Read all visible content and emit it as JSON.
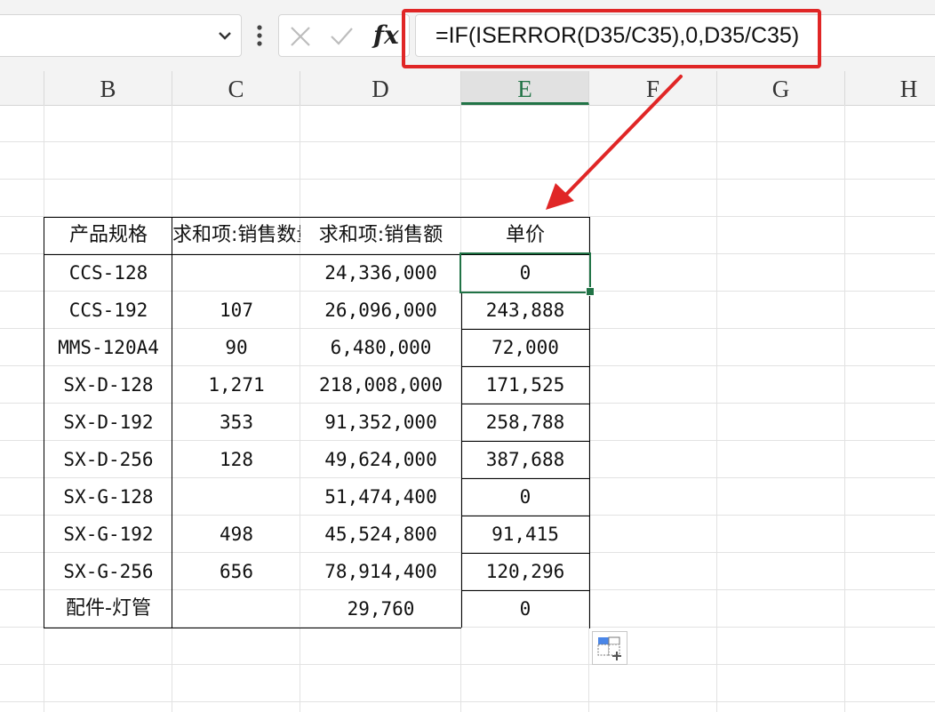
{
  "formula_bar": {
    "fx_label": "fx",
    "formula": "=IF(ISERROR(D35/C35),0,D35/C35)"
  },
  "columns": [
    "B",
    "C",
    "D",
    "E",
    "F",
    "G",
    "H"
  ],
  "selected_column": "E",
  "table": {
    "headers": [
      "产品规格",
      "求和项:销售数量",
      "求和项:销售额",
      "单价"
    ],
    "rows": [
      [
        "CCS-128",
        "",
        "24,336,000",
        "0"
      ],
      [
        "CCS-192",
        "107",
        "26,096,000",
        "243,888"
      ],
      [
        "MMS-120A4",
        "90",
        "6,480,000",
        "72,000"
      ],
      [
        "SX-D-128",
        "1,271",
        "218,008,000",
        "171,525"
      ],
      [
        "SX-D-192",
        "353",
        "91,352,000",
        "258,788"
      ],
      [
        "SX-D-256",
        "128",
        "49,624,000",
        "387,688"
      ],
      [
        "SX-G-128",
        "",
        "51,474,400",
        "0"
      ],
      [
        "SX-G-192",
        "498",
        "45,524,800",
        "91,415"
      ],
      [
        "SX-G-256",
        "656",
        "78,914,400",
        "120,296"
      ],
      [
        "配件-灯管",
        "",
        "29,760",
        "0"
      ]
    ]
  },
  "colors": {
    "highlight": "#e02626",
    "selection": "#217346"
  },
  "icons": {
    "namebox_dropdown": "chevron-down-icon",
    "more": "vertical-dots-icon",
    "cancel": "x-icon",
    "confirm": "check-icon",
    "quick_analysis": "quick-analysis-icon"
  }
}
